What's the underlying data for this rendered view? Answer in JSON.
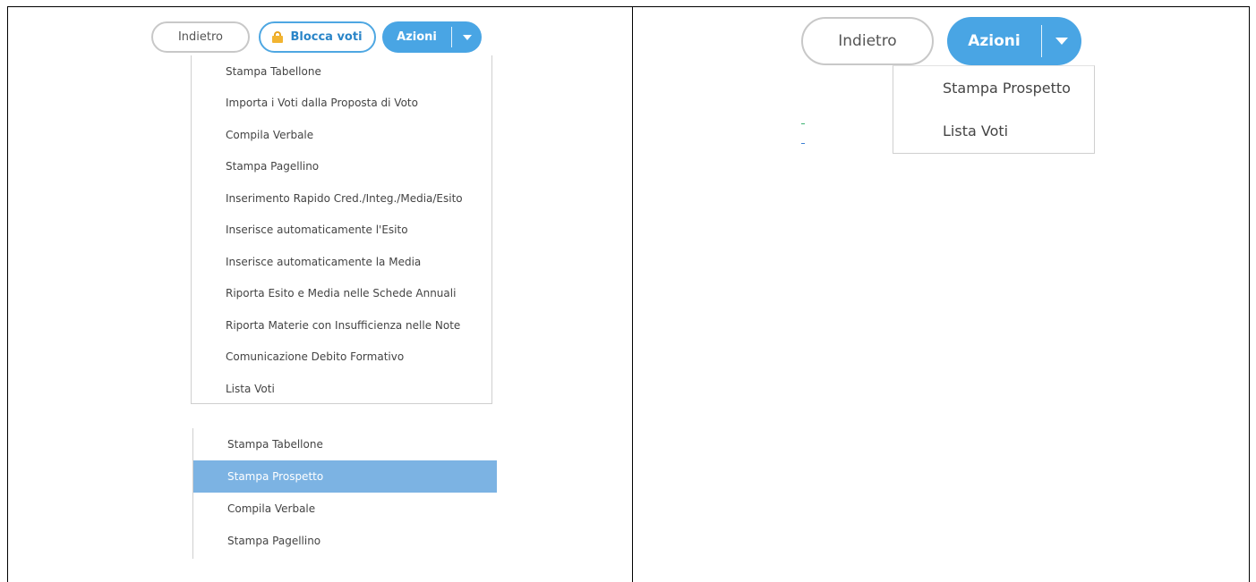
{
  "left": {
    "toolbar": {
      "back_label": "Indietro",
      "lock_label": "Blocca voti",
      "actions_label": "Azioni"
    },
    "actions_menu": {
      "items": [
        "Stampa Tabellone",
        "Importa i Voti dalla Proposta di Voto",
        "Compila Verbale",
        "Stampa Pagellino",
        "Inserimento Rapido Cred./Integ./Media/Esito",
        "Inserisce automaticamente l'Esito",
        "Inserisce automaticamente la Media",
        "Riporta Esito e Media nelle Schede Annuali",
        "Riporta Materie con Insufficienza nelle Note",
        "Comunicazione Debito Formativo",
        "Lista Voti"
      ]
    },
    "print_menu": {
      "items": [
        "Stampa Tabellone",
        "Stampa Prospetto",
        "Compila Verbale",
        "Stampa Pagellino"
      ],
      "selected_index": 1
    }
  },
  "right": {
    "toolbar": {
      "back_label": "Indietro",
      "actions_label": "Azioni"
    },
    "actions_menu": {
      "items": [
        "Stampa Prospetto",
        "Lista Voti"
      ]
    }
  },
  "colors": {
    "primary": "#49a5e4",
    "selected_row": "#7cb3e3",
    "lock_icon": "#f2b431",
    "tick_green": "#3cb371",
    "tick_blue": "#3a7fd5"
  },
  "icons": [
    "lock-icon",
    "caret-down-icon"
  ]
}
